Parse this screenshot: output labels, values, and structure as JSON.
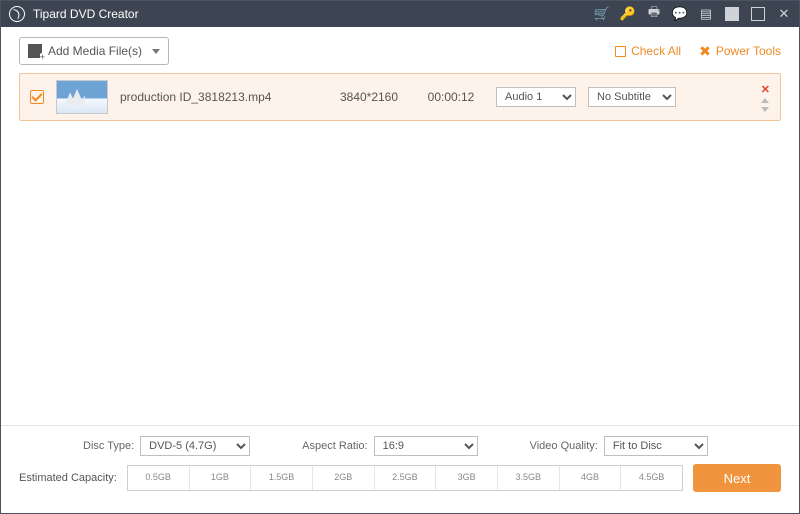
{
  "titlebar": {
    "title": "Tipard DVD Creator"
  },
  "toolbar": {
    "add_label": "Add Media File(s)",
    "check_all": "Check All",
    "power_tools": "Power Tools"
  },
  "files": [
    {
      "name": "production ID_3818213.mp4",
      "resolution": "3840*2160",
      "duration": "00:00:12",
      "audio": "Audio 1",
      "subtitle": "No Subtitle",
      "checked": true
    }
  ],
  "bottom": {
    "disc_type_label": "Disc Type:",
    "disc_type_value": "DVD-5 (4.7G)",
    "aspect_label": "Aspect Ratio:",
    "aspect_value": "16:9",
    "quality_label": "Video Quality:",
    "quality_value": "Fit to Disc",
    "capacity_label": "Estimated Capacity:",
    "ticks": [
      "0.5GB",
      "1GB",
      "1.5GB",
      "2GB",
      "2.5GB",
      "3GB",
      "3.5GB",
      "4GB",
      "4.5GB"
    ],
    "next": "Next"
  }
}
